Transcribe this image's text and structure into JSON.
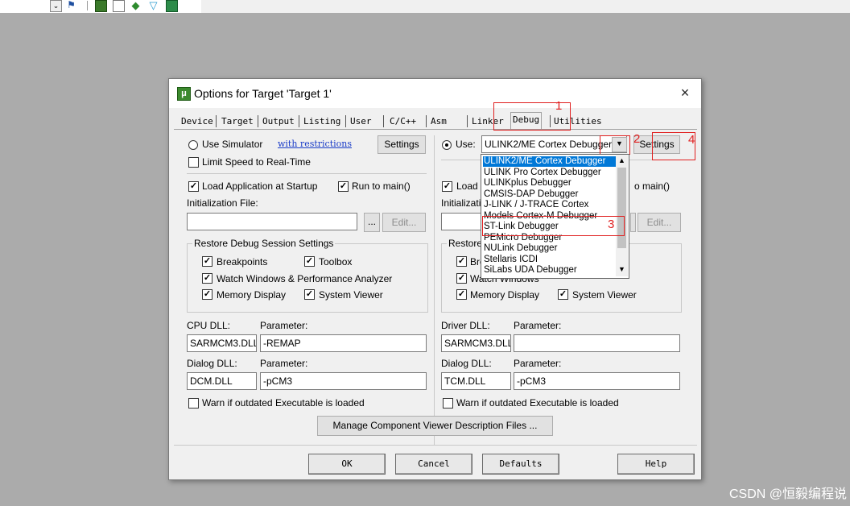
{
  "toolbar": {
    "icons": [
      "dropdown-arrow-icon",
      "network-icon",
      "tree-icon",
      "list-icon",
      "diamond-icon",
      "funnel-icon",
      "image-icon"
    ]
  },
  "dialog": {
    "title": "Options for Target 'Target 1'",
    "close": "×",
    "tabs": [
      "Device",
      "Target",
      "Output",
      "Listing",
      "User",
      "C/C++",
      "Asm",
      "Linker",
      "Debug",
      "Utilities"
    ],
    "active_tab": "Debug"
  },
  "left": {
    "use_simulator": "Use Simulator",
    "with_restrictions": "with restrictions",
    "settings": "Settings",
    "limit_speed": "Limit Speed to Real-Time",
    "load_app": "Load Application at Startup",
    "run_to_main": "Run to main()",
    "init_file_label": "Initialization File:",
    "browse": "...",
    "edit": "Edit...",
    "restore_title": "Restore Debug Session Settings",
    "breakpoints": "Breakpoints",
    "toolbox": "Toolbox",
    "watch": "Watch Windows & Performance Analyzer",
    "memory": "Memory Display",
    "sysviewer": "System Viewer",
    "cpu_dll_label": "CPU DLL:",
    "param_label": "Parameter:",
    "cpu_dll": "SARMCM3.DLL",
    "cpu_param": "-REMAP",
    "dialog_dll_label": "Dialog DLL:",
    "dialog_dll": "DCM.DLL",
    "dialog_param": "-pCM3",
    "warn": "Warn if outdated Executable is loaded"
  },
  "right": {
    "use": "Use:",
    "debugger_selected": "ULINK2/ME Cortex Debugger",
    "settings": "Settings",
    "load_partial": "Load",
    "run_partial": "o main()",
    "init_partial": "Initializatio",
    "edit": "Edit...",
    "restore_partial": "Restore",
    "breakpoints_partial": "Bre",
    "watch": "Watch Windows",
    "memory": "Memory Display",
    "sysviewer": "System Viewer",
    "driver_dll_label": "Driver DLL:",
    "param_label": "Parameter:",
    "driver_dll": "SARMCM3.DLL",
    "driver_param": "",
    "dialog_dll_label": "Dialog DLL:",
    "dialog_dll": "TCM.DLL",
    "dialog_param": "-pCM3",
    "warn": "Warn if outdated Executable is loaded"
  },
  "debugger_options": [
    "ULINK2/ME Cortex Debugger",
    "ULINK Pro Cortex Debugger",
    "ULINKplus Debugger",
    "CMSIS-DAP Debugger",
    "J-LINK / J-TRACE Cortex",
    "Models Cortex-M Debugger",
    "ST-Link Debugger",
    "PEMicro Debugger",
    "NULink Debugger",
    "Stellaris ICDI",
    "SiLabs UDA Debugger"
  ],
  "manage_btn": "Manage Component Viewer Description Files ...",
  "buttons": {
    "ok": "OK",
    "cancel": "Cancel",
    "defaults": "Defaults",
    "help": "Help"
  },
  "annotations": [
    "1",
    "2",
    "3",
    "4"
  ],
  "annotation_color": "#e02020",
  "selection_color": "#0078d7",
  "watermark": "CSDN @恒毅编程说"
}
